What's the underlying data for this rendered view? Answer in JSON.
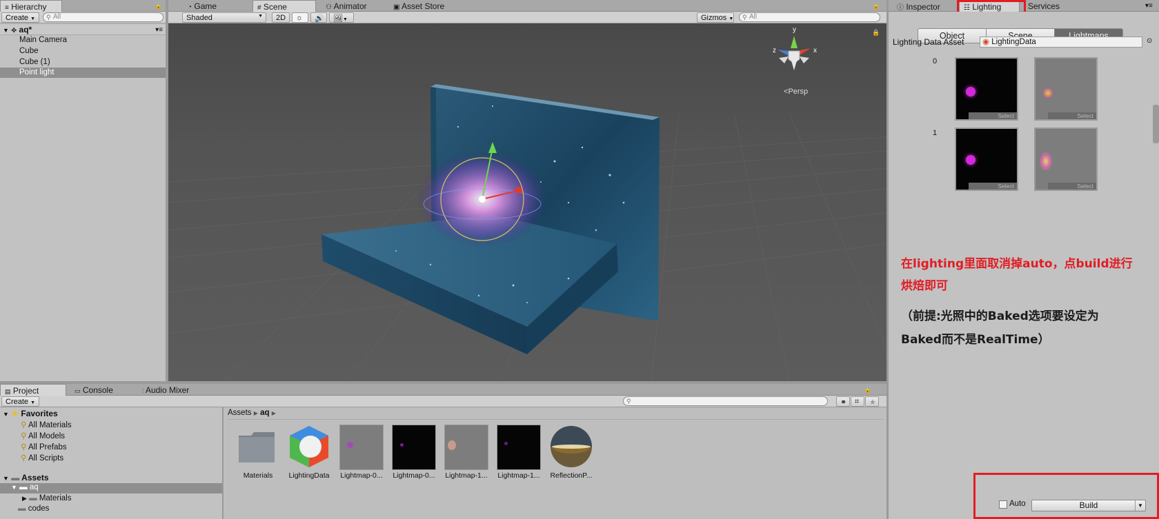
{
  "hierarchy": {
    "tab": "Hierarchy",
    "create": "Create",
    "search_placeholder": "All",
    "scene_name": "aq*",
    "items": [
      "Main Camera",
      "Cube",
      "Cube (1)",
      "Point light"
    ]
  },
  "scene_tabs": {
    "game": "Game",
    "scene": "Scene",
    "animator": "Animator",
    "asset_store": "Asset Store"
  },
  "scene_toolbar": {
    "shading": "Shaded",
    "mode_2d": "2D",
    "gizmos": "Gizmos",
    "search_placeholder": "All",
    "persp": "Persp",
    "axis_y": "y",
    "axis_x": "x",
    "axis_z": "z"
  },
  "project": {
    "tabs": [
      "Project",
      "Console",
      "Audio Mixer"
    ],
    "create": "Create",
    "favorites_label": "Favorites",
    "favorites": [
      "All Materials",
      "All Models",
      "All Prefabs",
      "All Scripts"
    ],
    "assets_label": "Assets",
    "folders": [
      {
        "name": "aq"
      },
      {
        "name": "Materials"
      },
      {
        "name": "codes"
      }
    ],
    "breadcrumb": [
      "Assets",
      "aq"
    ],
    "assets": [
      "Materials",
      "LightingData",
      "Lightmap-0...",
      "Lightmap-0...",
      "Lightmap-1...",
      "Lightmap-1...",
      "ReflectionP..."
    ]
  },
  "inspector_tabs": {
    "inspector": "Inspector",
    "lighting": "Lighting",
    "services": "Services"
  },
  "lighting": {
    "segments": [
      "Object",
      "Scene",
      "Lightmaps"
    ],
    "active_segment": "Lightmaps",
    "data_asset_label": "Lighting Data Asset",
    "data_asset_value": "LightingData",
    "lightmap_rows": [
      "0",
      "1"
    ],
    "select_label": "Select",
    "annotation_line1": "在lighting里面取消掉auto，点build进行",
    "annotation_line2": "烘焙即可",
    "annotation_line3": "（前提:光照中的Baked选项要设定为",
    "annotation_line4": "Baked而不是RealTime）",
    "auto_label": "Auto",
    "build_label": "Build"
  },
  "colors": {
    "highlight": "#e21c23",
    "selected_row": "#8f8f8f",
    "scene_bg": "#525252"
  }
}
